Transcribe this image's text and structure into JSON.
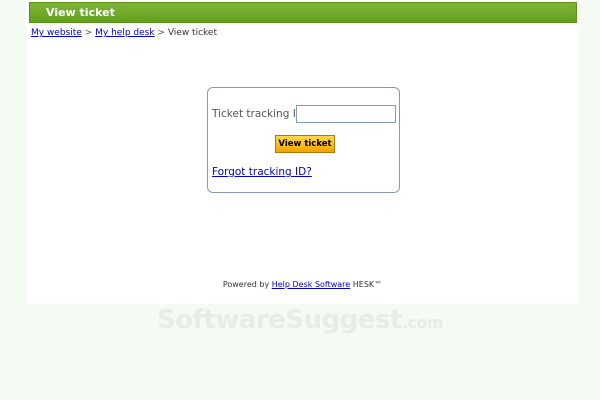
{
  "header": {
    "title": "View ticket"
  },
  "breadcrumb": {
    "links": [
      "My website",
      "My help desk"
    ],
    "separator": ">",
    "current": "View ticket"
  },
  "form": {
    "tracking_label": "Ticket tracking ID:",
    "tracking_value": "",
    "tracking_placeholder": "",
    "submit_label": "View ticket",
    "forgot_label": "Forgot tracking ID?"
  },
  "footer": {
    "prefix": "Powered by",
    "link": "Help Desk Software",
    "suffix": "HESK™"
  },
  "watermark": {
    "text": "SoftwareSuggest",
    "suffix": ".com"
  },
  "colors": {
    "header_green": "#62a01e",
    "button_orange": "#f3a400",
    "link_blue": "#0000cc",
    "background": "#f3fbf3"
  }
}
